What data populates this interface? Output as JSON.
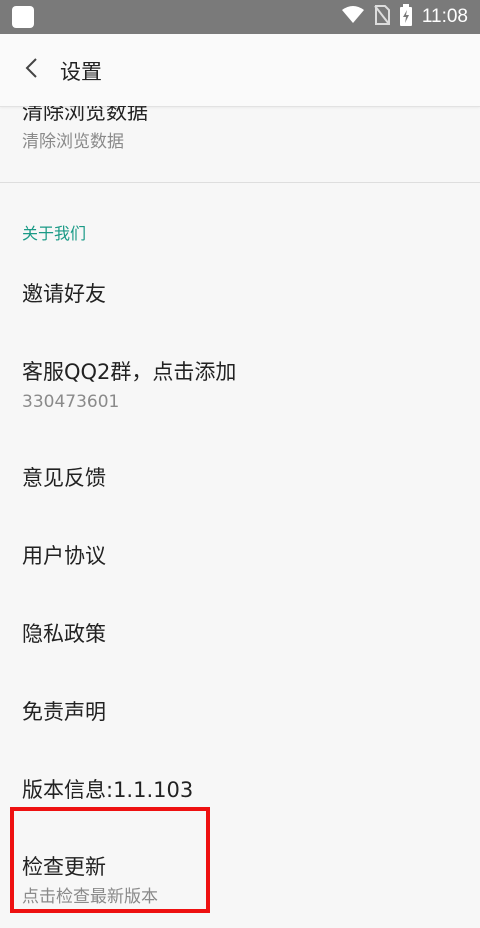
{
  "status_bar": {
    "time": "11:08",
    "icons": [
      "app-square-icon",
      "wifi-icon",
      "no-sim-icon",
      "battery-charging-icon"
    ]
  },
  "app_bar": {
    "back_icon": "chevron-left-icon",
    "title": "设置"
  },
  "settings": {
    "clear_data": {
      "title": "清除浏览数据",
      "subtitle": "清除浏览数据"
    },
    "section_about": "关于我们",
    "invite": "邀请好友",
    "qq_group": {
      "title": "客服QQ2群，点击添加",
      "subtitle": "330473601"
    },
    "feedback": "意见反馈",
    "user_agreement": "用户协议",
    "privacy": "隐私政策",
    "disclaimer": "免责声明",
    "version": "版本信息:1.1.103",
    "check_update": {
      "title": "检查更新",
      "subtitle": "点击检查最新版本"
    }
  },
  "colors": {
    "accent": "#1a9a86",
    "highlight": "#ee1111",
    "status_bar": "#7a7a7a",
    "background": "#f7f7f7"
  }
}
